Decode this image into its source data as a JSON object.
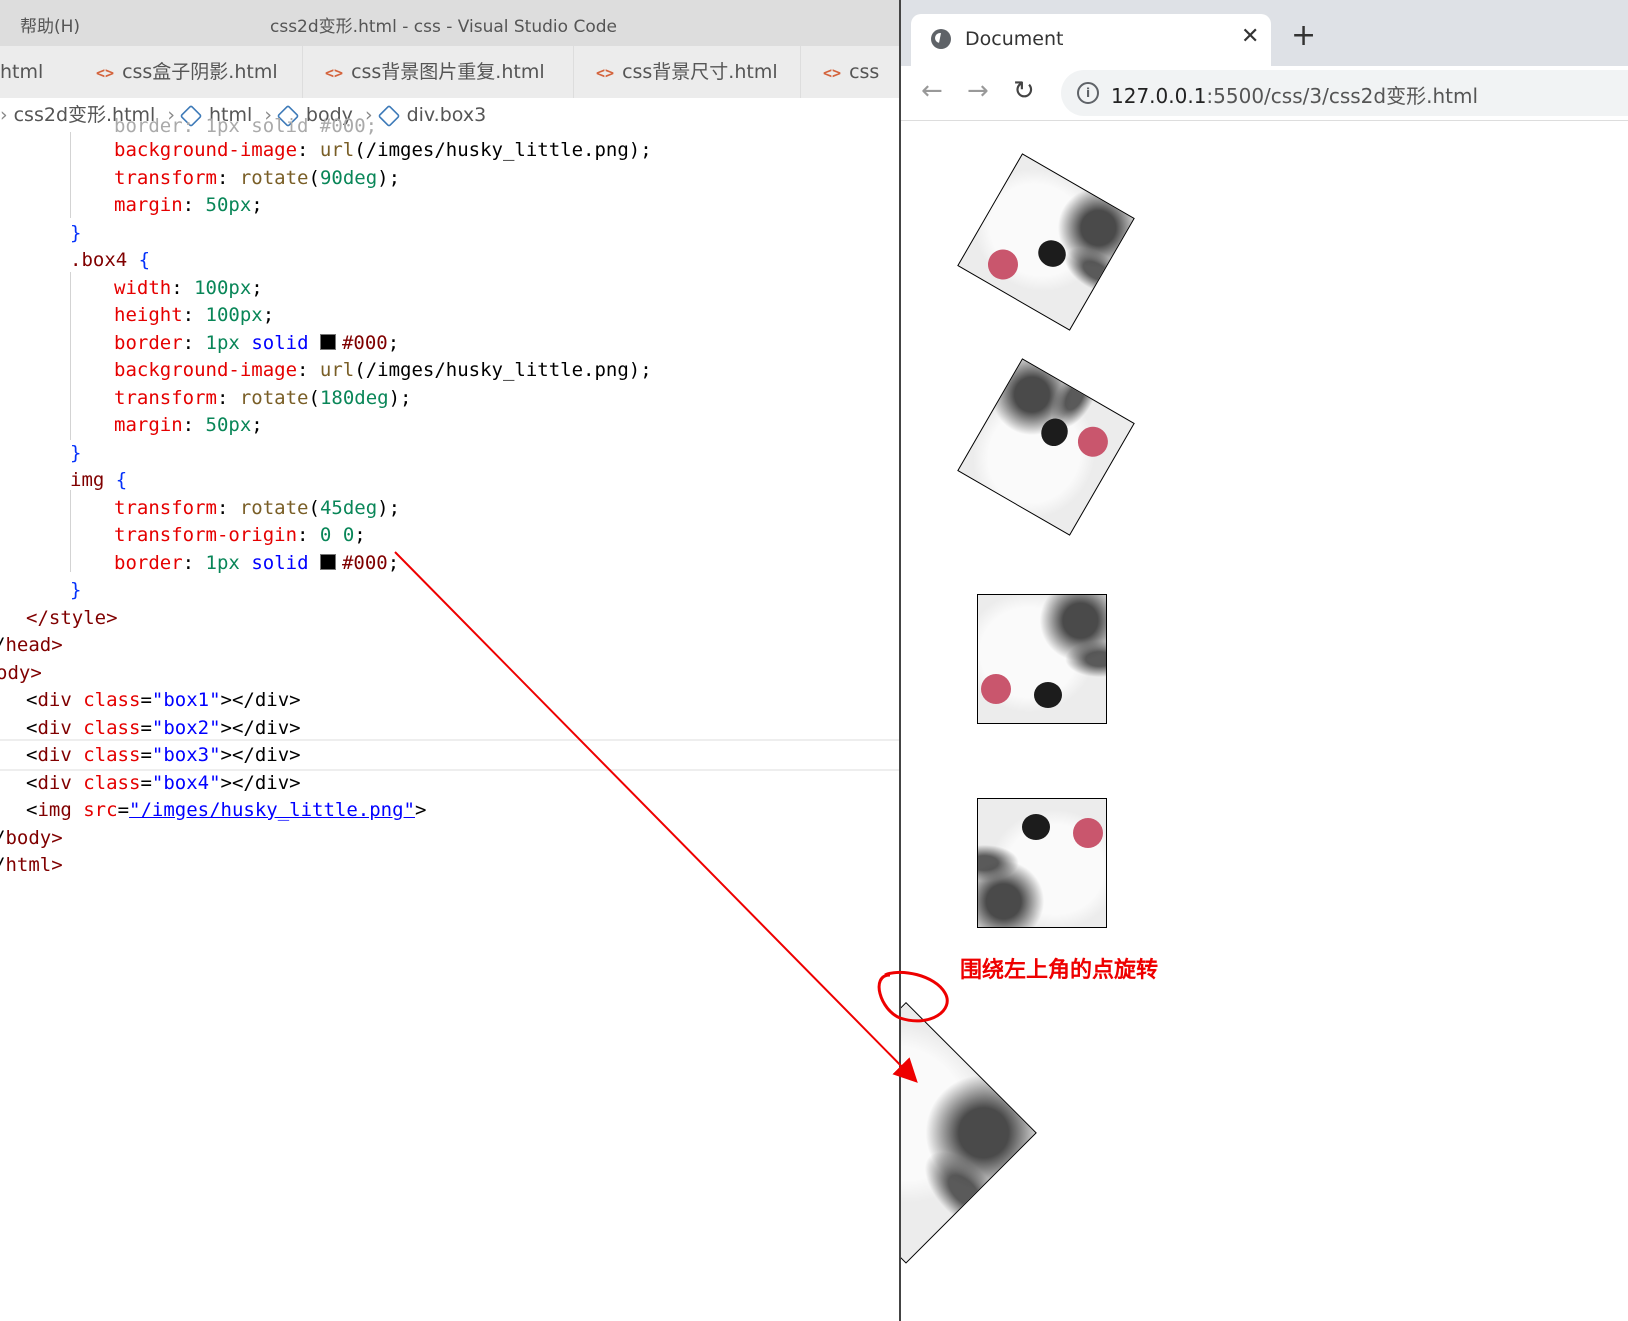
{
  "vscode": {
    "menu": "帮助(H)",
    "title": "css2d变形.html - css - Visual Studio Code",
    "tabs": [
      {
        "label": "html"
      },
      {
        "label": "css盒子阴影.html"
      },
      {
        "label": "css背景图片重复.html"
      },
      {
        "label": "css背景尺寸.html"
      },
      {
        "label": "css"
      }
    ],
    "tab_icon": "<>",
    "breadcrumb": {
      "file": "css2d变形.html",
      "items": [
        "html",
        "body",
        "div.box3"
      ]
    },
    "code": {
      "l0": "border: 1px solid #000;",
      "l1": [
        "background-image",
        "url",
        "(/imges/husky_little.png);"
      ],
      "l2": [
        "transform",
        "rotate",
        "90deg"
      ],
      "l3": [
        "margin",
        "50px"
      ],
      "l5": ".box4",
      "l6": [
        "width",
        "100px"
      ],
      "l7": [
        "height",
        "100px"
      ],
      "l8": [
        "border",
        "1px",
        "solid",
        "#000"
      ],
      "l9": [
        "background-image",
        "url",
        "(/imges/husky_little.png);"
      ],
      "l10": [
        "transform",
        "rotate",
        "180deg"
      ],
      "l11": [
        "margin",
        "50px"
      ],
      "l13": "img",
      "l14": [
        "transform",
        "rotate",
        "45deg"
      ],
      "l15": [
        "transform-origin",
        "0",
        "0"
      ],
      "l16": [
        "border",
        "1px",
        "solid",
        "#000"
      ],
      "l18": "</style>",
      "l19": "head>",
      "l20": "ody>",
      "l21": [
        "div",
        "class",
        "\"box1\"",
        "></div>"
      ],
      "l22": [
        "div",
        "class",
        "\"box2\"",
        "></div>"
      ],
      "l23": [
        "div",
        "class",
        "\"box3\"",
        "></div>"
      ],
      "l24": [
        "div",
        "class",
        "\"box4\"",
        "></div>"
      ],
      "l25": [
        "img",
        "src",
        "\"/imges/husky_little.png\"",
        ">"
      ],
      "l26": "body>",
      "l27": "html>"
    }
  },
  "browser": {
    "tab_title": "Document",
    "tab_close": "✕",
    "new_tab": "+",
    "back": "←",
    "forward": "→",
    "reload": "↻",
    "url_host": "127.0.0.1",
    "url_path": ":5500/css/3/css2d变形.html",
    "info_icon": "i"
  },
  "annotation": {
    "text": "围绕左上角的点旋转",
    "color": "#ee0000"
  },
  "colors": {
    "property": "#e50000",
    "number": "#098658",
    "tag": "#800000",
    "string": "#0000ff",
    "brace": "#0431fa",
    "function": "#795e26"
  }
}
